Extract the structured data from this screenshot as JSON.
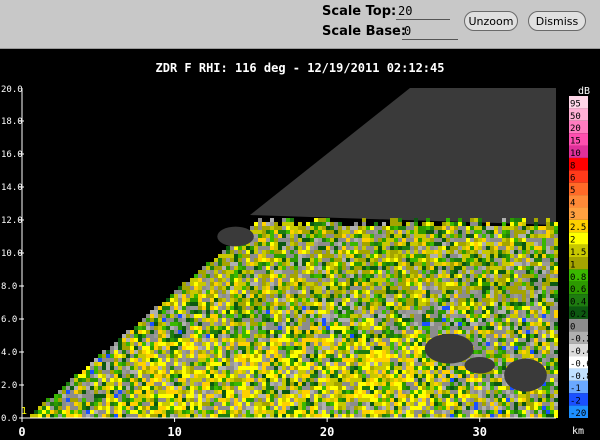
{
  "toolbar": {
    "scale_top_label": "Scale Top:",
    "scale_top_value": "20",
    "scale_base_label": "Scale Base:",
    "scale_base_value": "0",
    "unzoom_label": "Unzoom",
    "dismiss_label": "Dismiss"
  },
  "plot": {
    "title": "ZDR F  RHI: 116 deg  -  12/19/2011 02:12:45",
    "field": "ZDR F",
    "mode": "RHI",
    "azimuth_deg": 116,
    "timestamp": "12/19/2011 02:12:45",
    "y_corner_label": "20.0",
    "bottom_left_marker": "1"
  },
  "chart_data": {
    "type": "heatmap",
    "x": {
      "range": [
        0,
        35
      ],
      "ticks": [
        0,
        10,
        20,
        30
      ],
      "tick_labels": [
        "0",
        "10",
        "20",
        "30"
      ],
      "unit_label": "km"
    },
    "y": {
      "range": [
        0,
        20
      ],
      "ticks": [
        0,
        2,
        4,
        6,
        8,
        10,
        12,
        14,
        16,
        18
      ],
      "tick_labels": [
        "0.0",
        "2.0",
        "4.0",
        "6.0",
        "8.0",
        "10.0",
        "12.0",
        "14.0",
        "16.0",
        "18.0"
      ]
    },
    "colorbar": {
      "unit": "dB",
      "entries": [
        {
          "label": "95",
          "color": "#ffd6e8"
        },
        {
          "label": "50",
          "color": "#ffb0d4"
        },
        {
          "label": "20",
          "color": "#ff7cc0"
        },
        {
          "label": "15",
          "color": "#ff4fb0"
        },
        {
          "label": "10",
          "color": "#e0309a"
        },
        {
          "label": "8",
          "color": "#ff0000"
        },
        {
          "label": "6",
          "color": "#ff3a1a"
        },
        {
          "label": "5",
          "color": "#ff6a28"
        },
        {
          "label": "4",
          "color": "#ff8a38"
        },
        {
          "label": "3",
          "color": "#ffa040"
        },
        {
          "label": "2.5",
          "color": "#ffd000"
        },
        {
          "label": "2",
          "color": "#ffff00"
        },
        {
          "label": "1.5",
          "color": "#c8c800"
        },
        {
          "label": "1",
          "color": "#a4a400"
        },
        {
          "label": "0.8",
          "color": "#3ab800"
        },
        {
          "label": "0.6",
          "color": "#2c9a00"
        },
        {
          "label": "0.4",
          "color": "#1e7c10"
        },
        {
          "label": "0.2",
          "color": "#0c5810"
        },
        {
          "label": "0",
          "color": "#8c8c8c"
        },
        {
          "label": "-0.2",
          "color": "#b0b0b0"
        },
        {
          "label": "-0.4",
          "color": "#dcdcdc"
        },
        {
          "label": "-0.6",
          "color": "#ffffff"
        },
        {
          "label": "-0.8",
          "color": "#c0e0ff"
        },
        {
          "label": "-1",
          "color": "#6aa8ff"
        },
        {
          "label": "-2",
          "color": "#1a50ff"
        },
        {
          "label": "-20",
          "color": "#1e90ff"
        }
      ]
    },
    "grid": false
  }
}
